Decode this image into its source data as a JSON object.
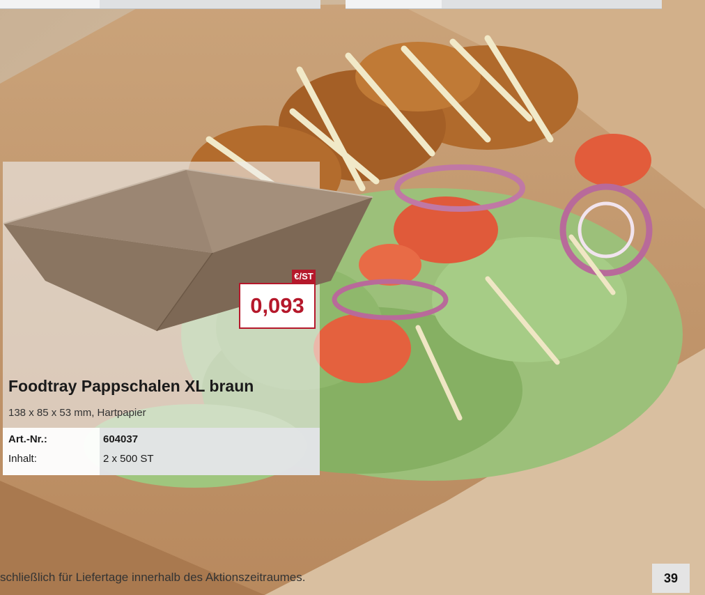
{
  "product": {
    "name": "Foodtray Pappschalen XL braun",
    "description": "138 x 85 x 53 mm, Hartpapier",
    "price_unit": "€/ST",
    "price": "0,093",
    "specs": [
      {
        "label": "Art.-Nr.:",
        "value": "604037",
        "bold": true
      },
      {
        "label": "Inhalt:",
        "value": "2 x 500 ST",
        "bold": false
      }
    ]
  },
  "footer": {
    "text": "schließlich für Liefertage innerhalb des Aktionszeitraumes.",
    "page_number": "39"
  },
  "colors": {
    "accent": "#b5182b",
    "tray_brown": "#8a7561",
    "lettuce": "#7fa65a",
    "tomato": "#e05a3a",
    "onion": "#b86a9a"
  }
}
